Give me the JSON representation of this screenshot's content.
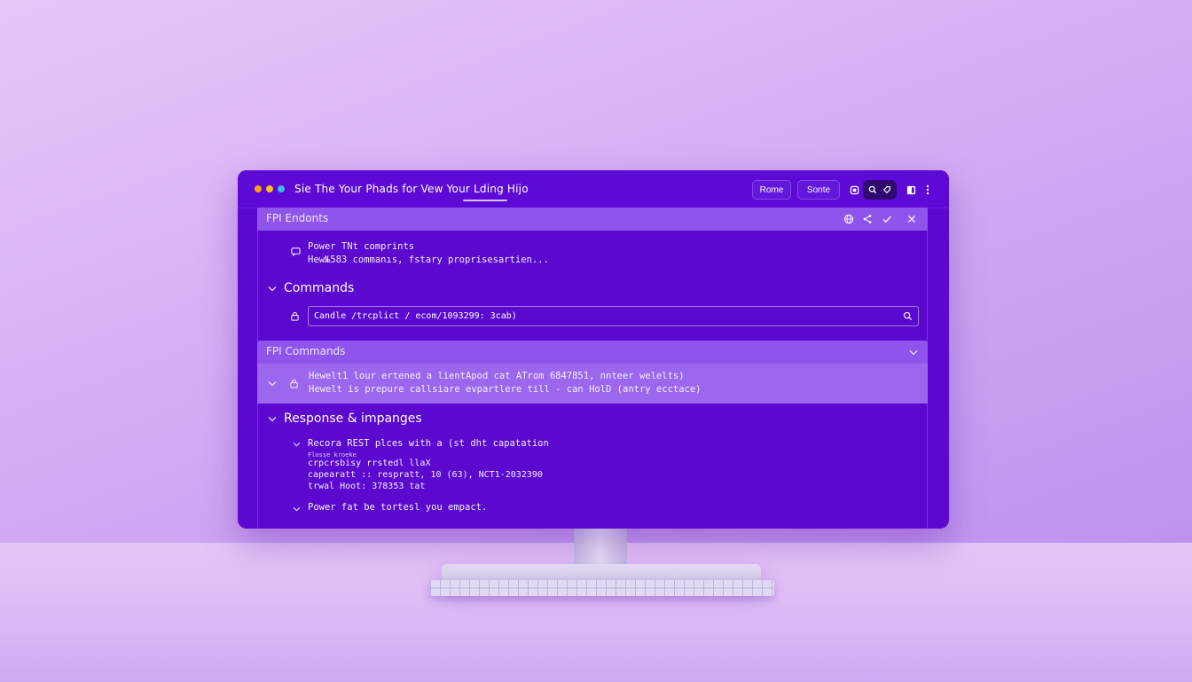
{
  "window": {
    "title": "Sie The Your Phads for Vew Your Lding Hijo",
    "buttons": {
      "home": "Rome",
      "source": "Sonte"
    },
    "colors": {
      "dot_red": "#ff9f1c",
      "dot_yellow": "#f7c21a",
      "dot_green": "#41b8f2",
      "accent": "#5b08cf"
    }
  },
  "panels": {
    "endpoints": {
      "label": "FPI Endonts",
      "item": {
        "line1": "Power TNt comprints",
        "line2": "Hew№583 commanıs, fstary proprisesartien..."
      }
    },
    "commands": {
      "title": "Commands",
      "search_value": "Candle /trcplict / ecom/1093299: 3cab)"
    },
    "fpi_commands": {
      "label": "FPI Commands",
      "row": {
        "line1": "Hewelt1 lour ertened a lientApod cat ATrom 6847851, nnteer welelts)",
        "line2": "Hewelt is prepure callsiare evpartlere till - can HolD (antry ecctace)"
      }
    },
    "response": {
      "title": "Response & impanges",
      "item1": {
        "line1": "Recora REST plces with a (st dht capatation",
        "line2": "Flosse kroeke",
        "line3": "crpcrsbisy rrstedl llaX",
        "line4": "capearatt :: respratt, 10 (63), NCT1-2032390",
        "line5": "trwal Hoot: 378353 tat"
      },
      "item2": {
        "line1": "Power fat be tortesl you empact."
      }
    }
  },
  "icons": {
    "traffic_lights": [
      "red-dot",
      "yellow-dot",
      "green-dot"
    ],
    "titlebar": [
      "window-icon",
      "search-icon",
      "tag-icon",
      "panel-icon",
      "more-icon"
    ],
    "panel_head": [
      "globe-icon",
      "share-icon",
      "check-icon",
      "close-icon"
    ]
  }
}
